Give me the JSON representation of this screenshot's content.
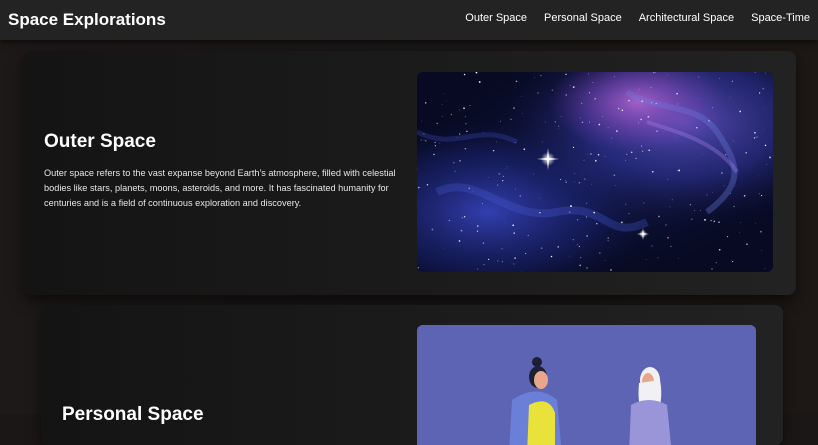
{
  "header": {
    "title": "Space Explorations",
    "nav": [
      "Outer Space",
      "Personal Space",
      "Architectural Space",
      "Space-Time"
    ]
  },
  "sections": [
    {
      "title": "Outer Space",
      "text": "Outer space refers to the vast expanse beyond Earth's atmosphere, filled with celestial bodies like stars, planets, moons, asteroids, and more. It has fascinated humanity for centuries and is a field of continuous exploration and discovery.",
      "image": "nebula-starfield-image"
    },
    {
      "title": "Personal Space",
      "image": "two-people-illustration"
    }
  ]
}
